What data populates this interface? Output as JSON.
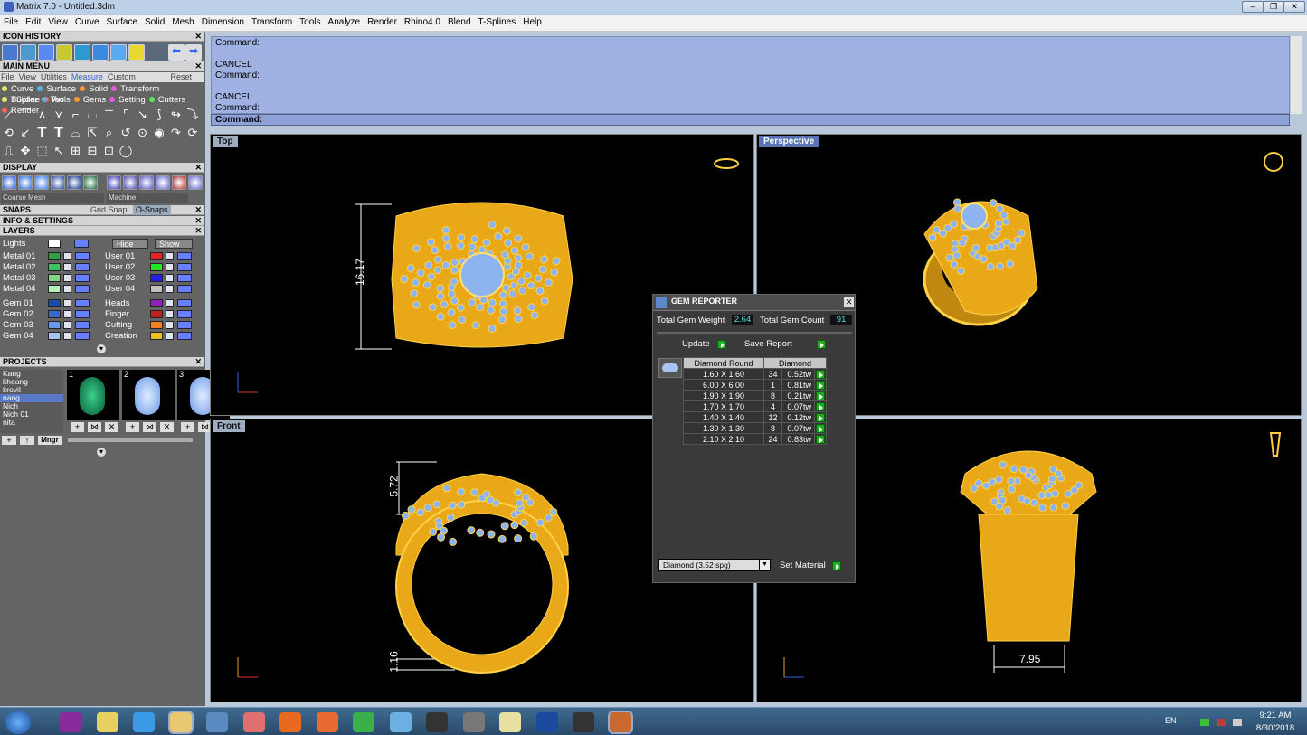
{
  "window": {
    "title": "Matrix 7.0 - Untitled.3dm"
  },
  "menubar": [
    "File",
    "Edit",
    "View",
    "Curve",
    "Surface",
    "Solid",
    "Mesh",
    "Dimension",
    "Transform",
    "Tools",
    "Analyze",
    "Render",
    "Rhino4.0",
    "Blend",
    "T-Splines",
    "Help"
  ],
  "left": {
    "icon_history": "ICON HISTORY",
    "main_menu": "MAIN MENU",
    "main_menu_tabs": [
      "File",
      "View",
      "Utilities",
      "Measure",
      "Custom"
    ],
    "reset": "Reset",
    "cats_row1": [
      "Curve",
      "Surface",
      "Solid",
      "Transform",
      "TSpline",
      "Art"
    ],
    "cats_row2": [
      "Builder",
      "Tools",
      "Gems",
      "Setting",
      "Cutters",
      "Render"
    ],
    "cat_colors": [
      "#e8e85a",
      "#5ab4e8",
      "#ff9a2a",
      "#e85ae8",
      "#5ae85a",
      "#ff6060"
    ],
    "display": "DISPLAY",
    "display_mode": "Coarse Mesh",
    "display_material": "Machine",
    "snaps": "SNAPS",
    "grid_snap": "Grid Snap",
    "o_snaps": "O-Snaps",
    "info": "INFO & SETTINGS",
    "layers": "LAYERS",
    "lights": "Lights",
    "hide": "Hide",
    "show": "Show",
    "layers_left": [
      {
        "name": "Metal 01",
        "color": "#2aa04a"
      },
      {
        "name": "Metal 02",
        "color": "#40c060"
      },
      {
        "name": "Metal 03",
        "color": "#7ed87e"
      },
      {
        "name": "Metal 04",
        "color": "#b8ecb8"
      },
      {
        "name": "Gem 01",
        "color": "#1e4aa8"
      },
      {
        "name": "Gem 02",
        "color": "#3a6ad0"
      },
      {
        "name": "Gem 03",
        "color": "#6a9ae8"
      },
      {
        "name": "Gem 04",
        "color": "#a8c4f0"
      }
    ],
    "layers_right": [
      {
        "name": "User 01",
        "color": "#e82020"
      },
      {
        "name": "User 02",
        "color": "#20e820"
      },
      {
        "name": "User 03",
        "color": "#2020e8"
      },
      {
        "name": "User 04",
        "color": "#c0c0c0"
      },
      {
        "name": "Heads",
        "color": "#9020c0"
      },
      {
        "name": "Finger",
        "color": "#c02020"
      },
      {
        "name": "Cutting",
        "color": "#f08020"
      },
      {
        "name": "Creation",
        "color": "#f0c020"
      }
    ],
    "projects": "PROJECTS",
    "project_list": [
      "Kang",
      "kheang",
      "krovil",
      "nang",
      "Nich",
      "Nich 01",
      "nita"
    ],
    "project_selected": "nang",
    "thumbs": [
      "1",
      "2",
      "3"
    ],
    "mngr": "Mngr"
  },
  "command": {
    "history": [
      "Command:",
      "",
      "CANCEL",
      "Command:",
      "",
      "CANCEL",
      "Command:"
    ],
    "prompt": "Command:"
  },
  "viewports": {
    "top": "Top",
    "perspective": "Perspective",
    "front": "Front",
    "dim_top": "16.17",
    "dim_front1": "5.72",
    "dim_front2": "1.16",
    "dim_right": "7.95"
  },
  "gem_reporter": {
    "title": "GEM REPORTER",
    "weight_label": "Total Gem Weight",
    "weight_value": "2.64",
    "count_label": "Total Gem Count",
    "count_value": "91",
    "update": "Update",
    "save_report": "Save Report",
    "col1": "Diamond Round",
    "col2": "Diamond",
    "rows": [
      [
        "1.60 X 1.60",
        "34",
        "0.52tw"
      ],
      [
        "6.00 X 6.00",
        "1",
        "0.81tw"
      ],
      [
        "1.90 X 1.90",
        "8",
        "0.21tw"
      ],
      [
        "1.70 X 1.70",
        "4",
        "0.07tw"
      ],
      [
        "1.40 X 1.40",
        "12",
        "0.12tw"
      ],
      [
        "1.30 X 1.30",
        "8",
        "0.07tw"
      ],
      [
        "2.10 X 2.10",
        "24",
        "0.83tw"
      ]
    ],
    "material": "Diamond      (3.52 spg)",
    "set_material": "Set Material"
  },
  "taskbar": {
    "lang": "EN",
    "time": "9:21 AM",
    "date": "8/30/2018",
    "pinned": [
      "start-orb",
      "premiere",
      "folder",
      "ie",
      "explorer",
      "calculator",
      "snipping",
      "firefox",
      "media",
      "chrome",
      "eraser",
      "tool",
      "zbrush",
      "notes",
      "matrix",
      "rhino",
      "paint"
    ]
  }
}
